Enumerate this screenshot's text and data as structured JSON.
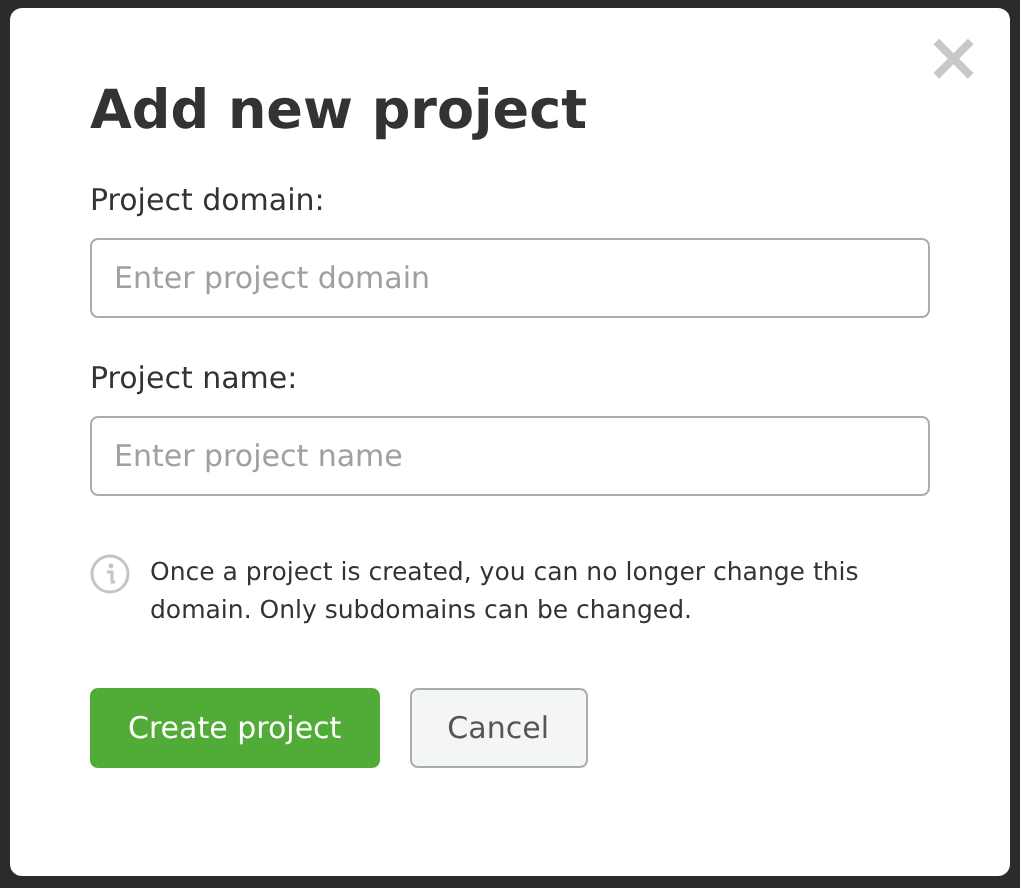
{
  "dialog": {
    "title": "Add new project",
    "close": "×"
  },
  "fields": [
    {
      "label": "Project domain:",
      "placeholder": "Enter project domain"
    },
    {
      "label": "Project name:",
      "placeholder": "Enter project name"
    }
  ],
  "notice": "Once a project is created, you can no longer change this domain. Only subdomains can be changed.",
  "buttons": [
    {
      "label": "Create project",
      "kind": "primary"
    },
    {
      "label": "Cancel",
      "kind": "secondary"
    }
  ]
}
